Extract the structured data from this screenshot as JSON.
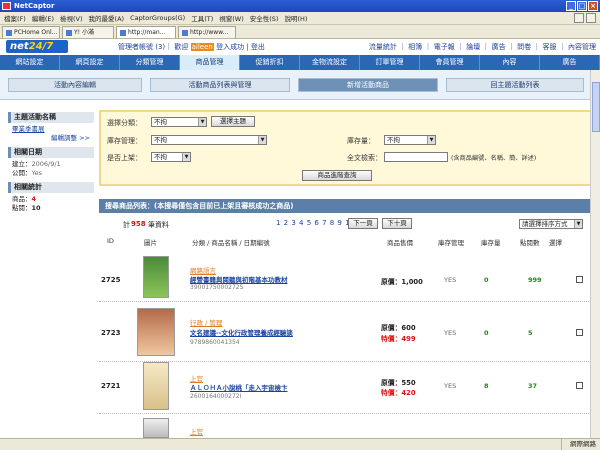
{
  "browser": {
    "title": "NetCaptor",
    "menu": [
      "檔案(F)",
      "編輯(E)",
      "檢視(V)",
      "我的最愛(A)",
      "CaptorGroups(G)",
      "工具(T)",
      "視窗(W)",
      "安全性(S)",
      "說明(H)"
    ],
    "tabs": [
      "PCHome Onl...",
      "Y! 小滿",
      "http://man...",
      "http://www..."
    ],
    "status_left": "",
    "status_zone": "網際網路"
  },
  "site": {
    "logo_a": "net",
    "logo_b": "24/7",
    "toplinks_prefix": "管理者帳號",
    "toplinks_mid": "(3)｜ 歡迎",
    "user": "aileen",
    "toplinks_suffix": "登入成功 | 登出",
    "rightlinks": "流量統計 ｜ 相簿 ｜ 電子報 ｜ 論壇 ｜ 廣告 ｜ 問卷 ｜ 客服 ｜ 內容管理",
    "mainnav": [
      "網站設定",
      "網頁設定",
      "分類管理",
      "商品管理",
      "促銷折扣",
      "金物流設定",
      "訂單管理",
      "會員管理",
      "內容",
      "廣告"
    ],
    "subtabs": [
      "活動內容編輯",
      "活動商品列表與管理",
      "新增活動商品",
      "回主題活動列表"
    ]
  },
  "sidebar": {
    "theme_head": "主題活動名稱",
    "theme_name": "畢業季書展",
    "edit_link": "編輯調整 >>",
    "date_head": "相關日期",
    "created_label": "建立：",
    "created": "2006/9/1",
    "public_label": "公開：",
    "public": "Yes",
    "stats_head": "相關統計",
    "items_label": "商品：",
    "items": "4",
    "clicks_label": "點閱：",
    "clicks": "10"
  },
  "filter": {
    "category_label": "選擇分類：",
    "category_value": "不拘",
    "choose_theme_btn": "選擇主題",
    "stock_label": "庫存管理：",
    "stock_value": "不拘",
    "stock_qty_label": "庫存量：",
    "stock_qty_value": "不拘",
    "listed_label": "是否上架：",
    "listed_value": "不拘",
    "keyword_label": "全文檢索：",
    "keyword_value": "",
    "keyword_hint": "(含商品編號、名稱、簡、詳述)",
    "search_btn": "商品進階查詢"
  },
  "list": {
    "header": "搜尋商品列表：(本搜尋僅包含目前已上架且審核成功之商品)",
    "total_prefix": "計",
    "total": "958",
    "total_suffix": "筆資料",
    "pages": "1 2 3 4 5 6 7 8 9 10",
    "prev_btn": "下一頁",
    "next_btn": "下十頁",
    "sort_value": "請選擇排序方式",
    "columns": [
      "ID",
      "圖片",
      "分類 / 商品名稱 / 日期編號",
      "商品售價",
      "庫存管理",
      "庫存量",
      "點閱數",
      "選擇"
    ]
  },
  "rows": [
    {
      "id": "2725",
      "category": "網路語言",
      "name": "經營書籍與閱聽與初階基本功教材",
      "isbn": "3900175000272S",
      "price_label": "原價：",
      "price": "1,000",
      "special_label": "",
      "special": "",
      "stock_mgmt": "YES",
      "stock": "0",
      "clicks": "999"
    },
    {
      "id": "2723",
      "category": "行政 / 管理",
      "name": "文名建議--文化行政管理養成經驗談",
      "isbn": "9789860041354",
      "price_label": "原價：",
      "price": "600",
      "special_label": "特價：",
      "special": "499",
      "stock_mgmt": "YES",
      "stock": "0",
      "clicks": "5"
    },
    {
      "id": "2721",
      "category": "上官",
      "name": "ＡＬＯＨＡ小說桃「走入宇宙檢卞",
      "isbn": "2600164000272I",
      "price_label": "原價：",
      "price": "550",
      "special_label": "特價：",
      "special": "420",
      "stock_mgmt": "YES",
      "stock": "8",
      "clicks": "37"
    },
    {
      "id": "",
      "category": "上官",
      "name": "",
      "isbn": "",
      "price_label": "",
      "price": "",
      "special_label": "",
      "special": "",
      "stock_mgmt": "",
      "stock": "",
      "clicks": ""
    }
  ]
}
